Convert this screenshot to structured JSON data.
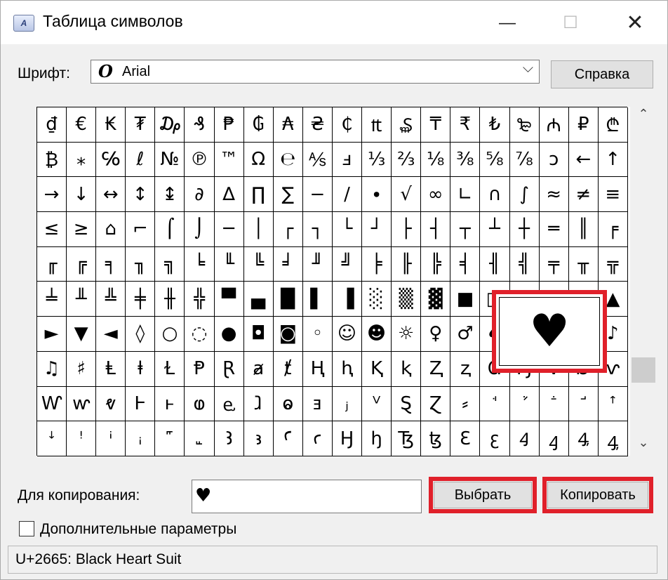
{
  "window": {
    "icon_label": "A",
    "title": "Таблица символов",
    "minimize": "—",
    "maximize": "☐",
    "close": "✕"
  },
  "font": {
    "label": "Шрифт:",
    "glyph": "O",
    "value": "Arial",
    "chevron": "⌵",
    "help_button": "Справка"
  },
  "grid": {
    "columns": 20,
    "rows": [
      [
        "₫",
        "€",
        "₭",
        "₮",
        "₯",
        "₰",
        "₱",
        "₲",
        "₳",
        "₴",
        "₵",
        "₶",
        "₷",
        "₸",
        "₹",
        "₺",
        "₻",
        "₼",
        "₽",
        "₾"
      ],
      [
        "₿",
        "⁎",
        "℅",
        "ℓ",
        "№",
        "℗",
        "™",
        "Ω",
        "℮",
        "⅍",
        "ⅎ",
        "⅓",
        "⅔",
        "⅛",
        "⅜",
        "⅝",
        "⅞",
        "ↄ",
        "←",
        "↑"
      ],
      [
        "→",
        "↓",
        "↔",
        "↕",
        "↨",
        "∂",
        "∆",
        "∏",
        "∑",
        "−",
        "∕",
        "∙",
        "√",
        "∞",
        "∟",
        "∩",
        "∫",
        "≈",
        "≠",
        "≡"
      ],
      [
        "≤",
        "≥",
        "⌂",
        "⌐",
        "⌠",
        "⌡",
        "─",
        "│",
        "┌",
        "┐",
        "└",
        "┘",
        "├",
        "┤",
        "┬",
        "┴",
        "┼",
        "═",
        "║",
        "╒"
      ],
      [
        "╓",
        "╔",
        "╕",
        "╖",
        "╗",
        "╘",
        "╙",
        "╚",
        "╛",
        "╜",
        "╝",
        "╞",
        "╟",
        "╠",
        "╡",
        "╢",
        "╣",
        "╤",
        "╥",
        "╦"
      ],
      [
        "╧",
        "╨",
        "╩",
        "╪",
        "╫",
        "╬",
        "▀",
        "▄",
        "█",
        "▌",
        "▐",
        "░",
        "▒",
        "▓",
        "■",
        "□",
        "▪",
        "▫",
        "▬",
        "▲"
      ],
      [
        "►",
        "▼",
        "◄",
        "◊",
        "○",
        "◌",
        "●",
        "◘",
        "◙",
        "◦",
        "☺",
        "☻",
        "☼",
        "♀",
        "♂",
        "♠",
        "♣",
        "♥",
        "♦",
        "♪"
      ],
      [
        "♫",
        "♯",
        "Ⱡ",
        "ⱡ",
        "Ɫ",
        "Ᵽ",
        "Ɽ",
        "ⱥ",
        "ⱦ",
        "Ⱨ",
        "ⱨ",
        "Ⱪ",
        "ⱪ",
        "Ⱬ",
        "ⱬ",
        "Ɑ",
        "Ɱ",
        "Ɐ",
        "Ɒ",
        "ⱱ"
      ],
      [
        "Ⱳ",
        "ⱳ",
        "ⱴ",
        "Ⱶ",
        "ⱶ",
        "ⱷ",
        "ⱸ",
        "ⱹ",
        "ⱺ",
        "ⱻ",
        "ⱼ",
        "ⱽ",
        "Ȿ",
        "Ɀ",
        "⸗",
        "ꜗ",
        "ꜘ",
        "ꜙ",
        "ꜚ",
        "ꜛ"
      ],
      [
        "ꜜ",
        "ꜝ",
        "ꜞ",
        "ꜟ",
        "꜠",
        "꜡",
        "Ꜣ",
        "ꜣ",
        "Ꜥ",
        "ꜥ",
        "Ꜧ",
        "ꜧ",
        "Ꜩ",
        "ꜩ",
        "Ꜫ",
        "ꜫ",
        "Ꜭ",
        "ꜭ",
        "Ꜯ",
        "ꜯ"
      ]
    ]
  },
  "scrollbar": {
    "up": "⌃",
    "down": "⌄"
  },
  "zoom": {
    "glyph": "♥"
  },
  "copy": {
    "label": "Для копирования:",
    "value": "♥",
    "select_button": "Выбрать",
    "copy_button": "Копировать"
  },
  "advanced": {
    "label": "Дополнительные параметры"
  },
  "status": {
    "text": "U+2665: Black Heart Suit"
  },
  "colors": {
    "highlight": "#e0202a",
    "button_bg": "#e1e1e1",
    "window_bg": "#f0f0f0"
  }
}
